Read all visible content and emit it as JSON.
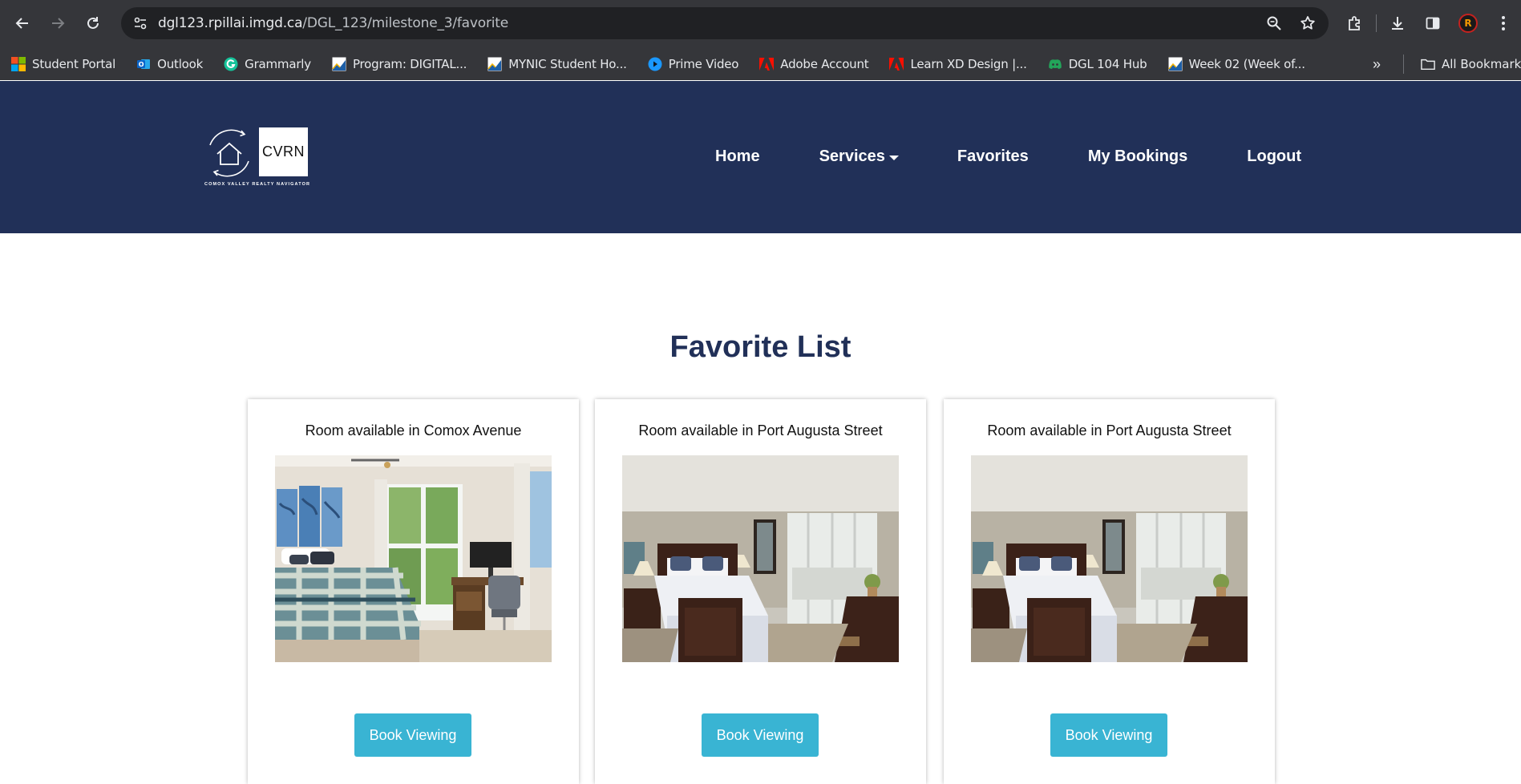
{
  "browser": {
    "url_host": "dgl123.rpillai.imgd.ca",
    "url_path": "/DGL_123/milestone_3/favorite",
    "profile_initial": "R",
    "bookmarks": [
      {
        "label": "Student Portal",
        "icon": "microsoft-icon"
      },
      {
        "label": "Outlook",
        "icon": "outlook-icon"
      },
      {
        "label": "Grammarly",
        "icon": "grammarly-icon"
      },
      {
        "label": "Program: DIGITAL...",
        "icon": "d2l-icon"
      },
      {
        "label": "MYNIC Student Ho...",
        "icon": "d2l-icon"
      },
      {
        "label": "Prime Video",
        "icon": "prime-video-icon"
      },
      {
        "label": "Adobe Account",
        "icon": "adobe-icon"
      },
      {
        "label": "Learn XD Design |...",
        "icon": "adobe-icon"
      },
      {
        "label": "DGL 104 Hub",
        "icon": "discord-icon"
      },
      {
        "label": "Week 02 (Week of...",
        "icon": "d2l-icon"
      }
    ],
    "all_bookmarks_label": "All Bookmarks",
    "colors": {
      "chrome_bg": "#35363a",
      "omnibox_bg": "#202124"
    }
  },
  "site": {
    "logo_text": "CVRN",
    "logo_tagline": "COMOX VALLEY REALTY NAVIGATOR",
    "nav": {
      "home": "Home",
      "services": "Services",
      "favorites": "Favorites",
      "bookings": "My Bookings",
      "logout": "Logout"
    },
    "colors": {
      "header_bg": "#213058",
      "button_bg": "#39b4d3",
      "title": "#213058"
    }
  },
  "main": {
    "title": "Favorite List",
    "cards": [
      {
        "title": "Room available in Comox Avenue",
        "button": "Book Viewing",
        "image": "bedroom-photo-plaid"
      },
      {
        "title": "Room available in Port Augusta Street",
        "button": "Book Viewing",
        "image": "bedroom-photo-dark-wood"
      },
      {
        "title": "Room available in Port Augusta Street",
        "button": "Book Viewing",
        "image": "bedroom-photo-dark-wood"
      }
    ]
  }
}
